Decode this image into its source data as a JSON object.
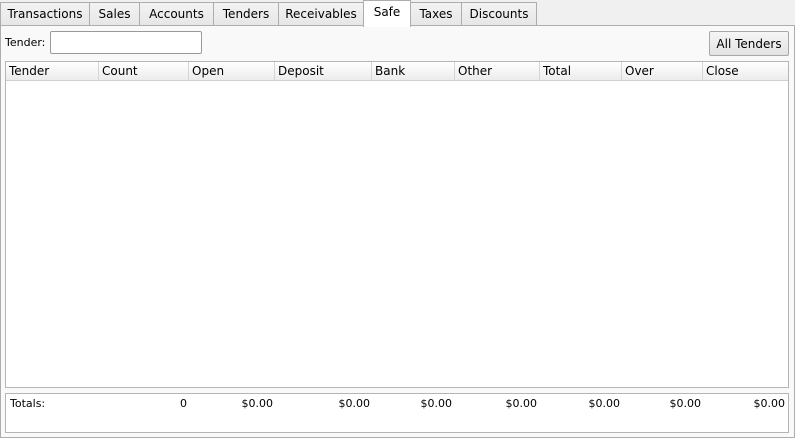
{
  "tabs": [
    {
      "label": "Transactions",
      "active": false
    },
    {
      "label": "Sales",
      "active": false
    },
    {
      "label": "Accounts",
      "active": false
    },
    {
      "label": "Tenders",
      "active": false
    },
    {
      "label": "Receivables",
      "active": false
    },
    {
      "label": "Safe",
      "active": true
    },
    {
      "label": "Taxes",
      "active": false
    },
    {
      "label": "Discounts",
      "active": false
    }
  ],
  "filter": {
    "tender_label": "Tender:",
    "tender_value": "",
    "all_tenders_label": "All Tenders"
  },
  "grid": {
    "columns": [
      "Tender",
      "Count",
      "Open",
      "Deposit",
      "Bank",
      "Other",
      "Total",
      "Over",
      "Close"
    ],
    "rows": []
  },
  "totals": {
    "label": "Totals:",
    "count": "0",
    "open": "$0.00",
    "deposit": "$0.00",
    "bank": "$0.00",
    "other": "$0.00",
    "total": "$0.00",
    "over": "$0.00",
    "close": "$0.00"
  }
}
